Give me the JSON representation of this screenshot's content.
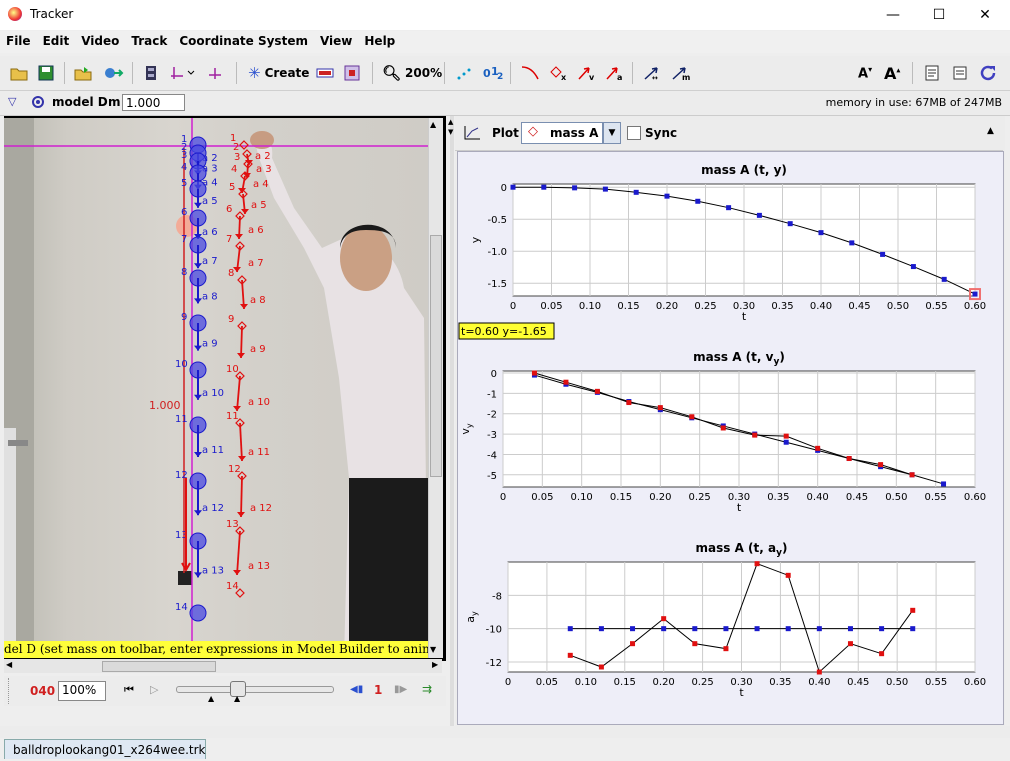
{
  "window": {
    "title": "Tracker",
    "minimize": "—",
    "maximize": "☐",
    "close": "✕"
  },
  "menu": [
    "File",
    "Edit",
    "Video",
    "Track",
    "Coordinate System",
    "View",
    "Help"
  ],
  "toolbar": {
    "create_label": "Create",
    "zoom_label": "200%",
    "memory": "memory in use: 67MB of 247MB"
  },
  "trackbar": {
    "track_name": "model D",
    "mass_label": "m",
    "mass_value": "1.000"
  },
  "video": {
    "status": "del D (set mass on toolbar, enter expressions in Model Builder to animate)",
    "calibration_label": "1.000",
    "blue_labels": [
      "1",
      "2",
      "3",
      "4",
      "5",
      "6",
      "7",
      "8",
      "9",
      "10",
      "11",
      "12",
      "13",
      "14"
    ],
    "red_labels": [
      "1",
      "2",
      "3",
      "4",
      "5",
      "6",
      "7",
      "8",
      "9",
      "10",
      "11",
      "12",
      "13",
      "14"
    ],
    "blue_accel_labels": [
      "a 2",
      "a 3",
      "a 4",
      "a 5",
      "a 6",
      "a 7",
      "a 8",
      "a 9",
      "a 10",
      "a 11",
      "a 12",
      "a 13"
    ],
    "red_accel_labels": [
      "a 2",
      "a 3",
      "a 4",
      "a 5",
      "a 6",
      "a 7",
      "a 8",
      "a 9",
      "a 10",
      "a 11",
      "a 12",
      "a 13"
    ]
  },
  "player": {
    "frame": "040",
    "zoom": "100%",
    "step": "1"
  },
  "plot_header": {
    "plot_label": "Plot",
    "track": "mass A",
    "sync_label": "Sync"
  },
  "file_tab": "balldroplookang01_x264wee.trk",
  "colors": {
    "blue": "#1a1acc",
    "red": "#e01010",
    "magenta": "#d020d0",
    "readout_bg": "#ffff33"
  },
  "chart_data": [
    {
      "type": "line",
      "title": "mass A (t, y)",
      "xlabel": "t",
      "ylabel": "y",
      "xlim": [
        0,
        0.6
      ],
      "ylim": [
        -1.7,
        0.05
      ],
      "x_ticks": [
        "0",
        "0.05",
        "0.10",
        "0.15",
        "0.20",
        "0.25",
        "0.30",
        "0.35",
        "0.40",
        "0.45",
        "0.50",
        "0.55",
        "0.60"
      ],
      "y_ticks": [
        "0",
        "-0.5",
        "-1.0",
        "-1.5"
      ],
      "readout": "t=0.60  y=-1.65",
      "series": [
        {
          "color": "#1a1acc",
          "x": [
            0,
            0.04,
            0.08,
            0.12,
            0.16,
            0.2,
            0.24,
            0.28,
            0.32,
            0.36,
            0.4,
            0.44,
            0.48,
            0.52,
            0.56,
            0.6
          ],
          "y": [
            0,
            0.0,
            -0.01,
            -0.03,
            -0.08,
            -0.14,
            -0.22,
            -0.32,
            -0.44,
            -0.57,
            -0.71,
            -0.87,
            -1.05,
            -1.24,
            -1.44,
            -1.67
          ]
        }
      ]
    },
    {
      "type": "line",
      "title": "mass A (t, vy)",
      "xlabel": "t",
      "ylabel": "vy",
      "xlim": [
        0,
        0.6
      ],
      "ylim": [
        -5.6,
        0.1
      ],
      "x_ticks": [
        "0",
        "0.05",
        "0.10",
        "0.15",
        "0.20",
        "0.25",
        "0.30",
        "0.35",
        "0.40",
        "0.45",
        "0.50",
        "0.55",
        "0.60"
      ],
      "y_ticks": [
        "0",
        "-1",
        "-2",
        "-3",
        "-4",
        "-5"
      ],
      "series": [
        {
          "color": "#1a1acc",
          "x": [
            0.04,
            0.08,
            0.12,
            0.16,
            0.2,
            0.24,
            0.28,
            0.32,
            0.36,
            0.4,
            0.44,
            0.48,
            0.52,
            0.56
          ],
          "y": [
            -0.1,
            -0.55,
            -0.95,
            -1.4,
            -1.8,
            -2.2,
            -2.6,
            -3.0,
            -3.4,
            -3.8,
            -4.2,
            -4.6,
            -5.0,
            -5.45
          ]
        },
        {
          "color": "#e01010",
          "x": [
            0.04,
            0.08,
            0.12,
            0.16,
            0.2,
            0.24,
            0.28,
            0.32,
            0.36,
            0.4,
            0.44,
            0.48,
            0.52
          ],
          "y": [
            0.0,
            -0.45,
            -0.9,
            -1.45,
            -1.7,
            -2.15,
            -2.7,
            -3.05,
            -3.1,
            -3.7,
            -4.2,
            -4.5,
            -5.0
          ]
        }
      ]
    },
    {
      "type": "line",
      "title": "mass A (t, ay)",
      "xlabel": "t",
      "ylabel": "ay",
      "xlim": [
        0,
        0.6
      ],
      "ylim": [
        -12.6,
        -6.0
      ],
      "x_ticks": [
        "0",
        "0.05",
        "0.10",
        "0.15",
        "0.20",
        "0.25",
        "0.30",
        "0.35",
        "0.40",
        "0.45",
        "0.50",
        "0.55",
        "0.60"
      ],
      "y_ticks": [
        "-8",
        "-10",
        "-12"
      ],
      "series": [
        {
          "color": "#1a1acc",
          "x": [
            0.08,
            0.12,
            0.16,
            0.2,
            0.24,
            0.28,
            0.32,
            0.36,
            0.4,
            0.44,
            0.48,
            0.52
          ],
          "y": [
            -10,
            -10,
            -10,
            -10,
            -10,
            -10,
            -10,
            -10,
            -10,
            -10,
            -10,
            -10
          ]
        },
        {
          "color": "#e01010",
          "x": [
            0.08,
            0.12,
            0.16,
            0.2,
            0.24,
            0.28,
            0.32,
            0.36,
            0.4,
            0.44,
            0.48,
            0.52
          ],
          "y": [
            -11.6,
            -12.3,
            -10.9,
            -9.4,
            -10.9,
            -11.2,
            -6.1,
            -6.8,
            -12.6,
            -10.9,
            -11.5,
            -8.9
          ]
        }
      ]
    }
  ]
}
